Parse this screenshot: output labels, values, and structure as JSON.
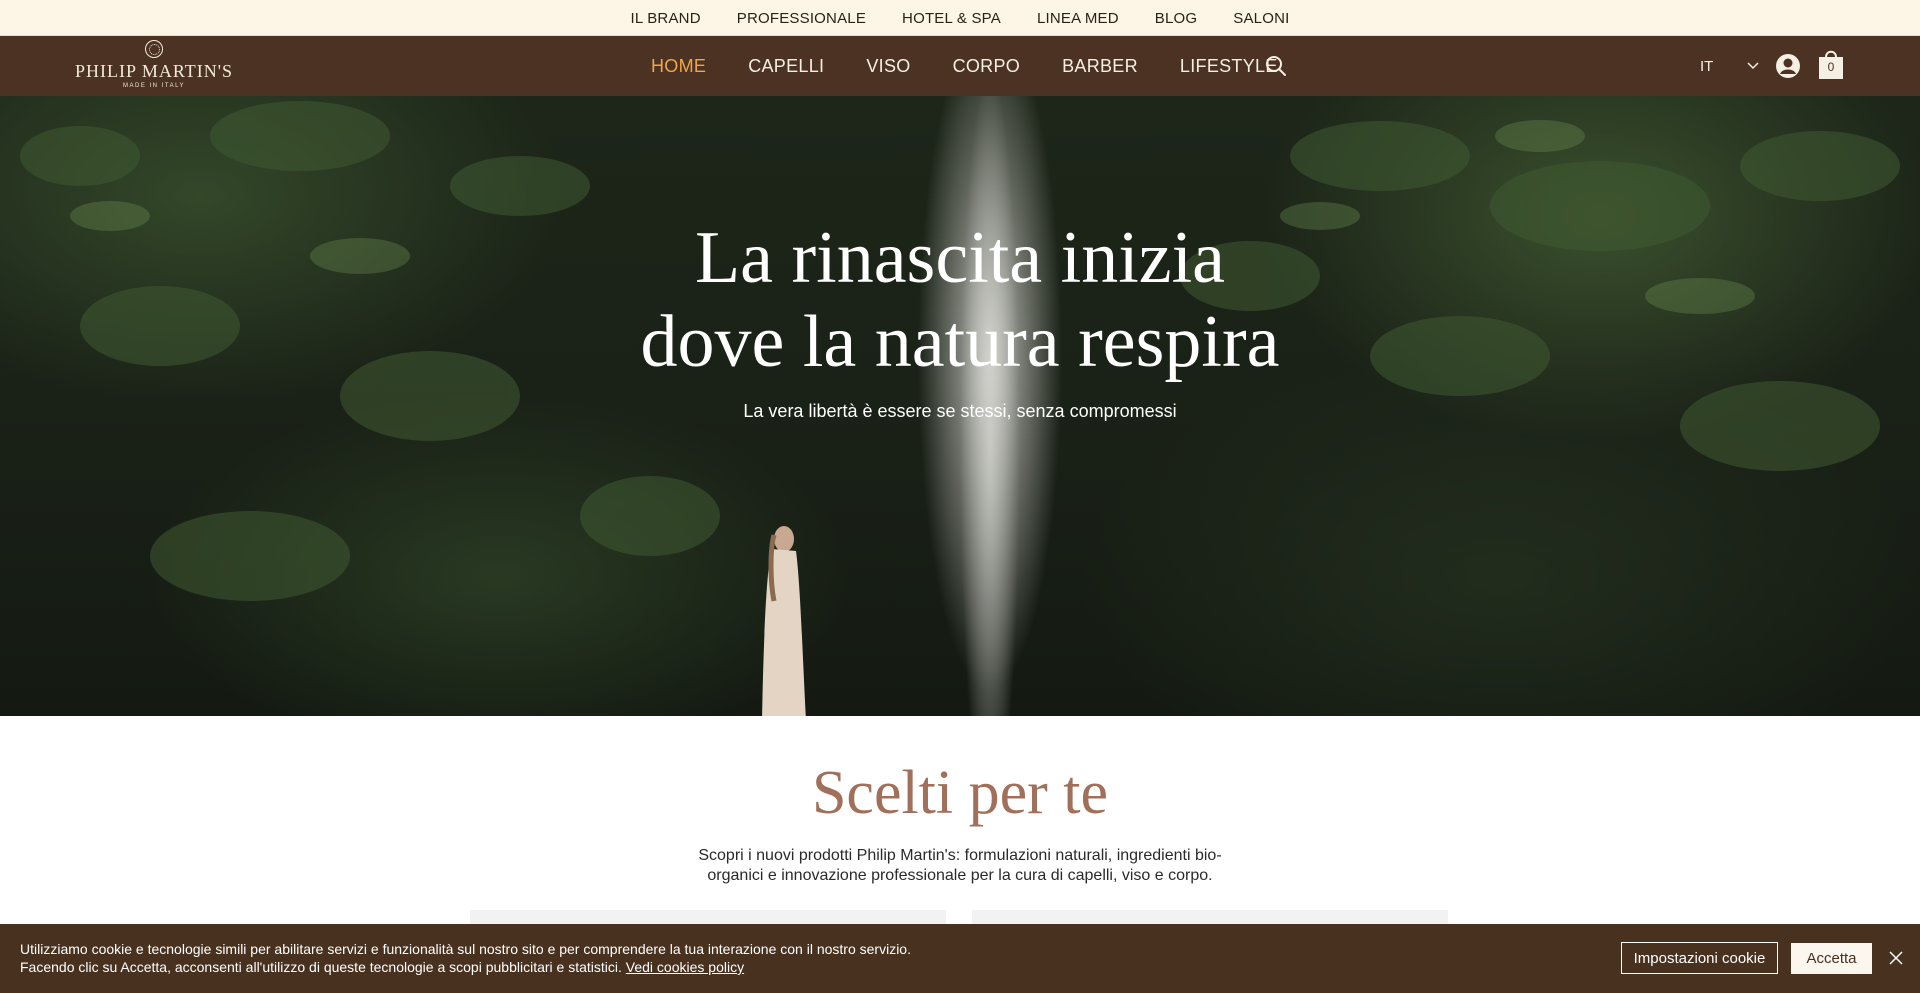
{
  "top_menu": {
    "items": [
      "IL BRAND",
      "PROFESSIONALE",
      "HOTEL & SPA",
      "LINEA MED",
      "BLOG",
      "SALONI"
    ]
  },
  "header": {
    "logo": {
      "brand": "PHILIP MARTIN'S",
      "tagline": "MADE IN ITALY"
    },
    "nav": [
      "HOME",
      "CAPELLI",
      "VISO",
      "CORPO",
      "BARBER",
      "LIFESTYLE"
    ],
    "active_nav": "HOME",
    "language": "IT",
    "cart_count": "0",
    "icons": [
      "search-icon",
      "chevron-down-icon",
      "user-icon",
      "cart-icon"
    ]
  },
  "hero": {
    "title_line1": "La rinascita inizia",
    "title_line2": "dove la natura respira",
    "subtitle": "La vera libertà è essere se stessi, senza compromessi"
  },
  "featured": {
    "title": "Scelti per te",
    "description_line1": "Scopri i nuovi prodotti Philip Martin's: formulazioni naturali, ingredienti bio-",
    "description_line2": "organici e innovazione professionale per la cura di capelli, viso e corpo."
  },
  "cookie_banner": {
    "line1": "Utilizziamo cookie e tecnologie simili per abilitare servizi e funzionalità sul nostro sito e per comprendere la tua interazione con il nostro servizio.",
    "line2": "Facendo clic su Accetta, acconsenti all'utilizzo di queste tecnologie a scopi pubblicitari e statistici.",
    "policy_link": "Vedi cookies policy",
    "settings_button": "Impostazioni cookie",
    "accept_button": "Accetta"
  },
  "colors": {
    "top_bar_bg": "#fdf5e6",
    "nav_bg": "#4b3222",
    "nav_active": "#f0a64c",
    "section_title": "#a0705a",
    "cookie_bg": "#48311f"
  }
}
